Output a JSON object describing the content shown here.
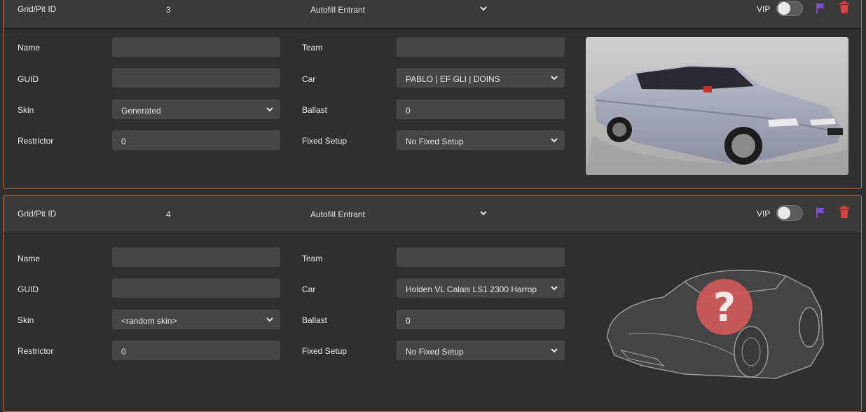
{
  "entrants": [
    {
      "header": {
        "grid_label": "Grid/Pit ID",
        "grid_value": "3",
        "autofill_label": "Autofill Entrant",
        "vip_label": "VIP"
      },
      "fields": {
        "name_label": "Name",
        "name_value": "",
        "guid_label": "GUID",
        "guid_value": "",
        "skin_label": "Skin",
        "skin_value": "Generated",
        "restrictor_label": "Restrictor",
        "restrictor_value": "0",
        "team_label": "Team",
        "team_value": "",
        "car_label": "Car",
        "car_value": "PABLO | EF GLI | DOINS",
        "ballast_label": "Ballast",
        "ballast_value": "0",
        "setup_label": "Fixed Setup",
        "setup_value": "No Fixed Setup"
      }
    },
    {
      "header": {
        "grid_label": "Grid/Pit ID",
        "grid_value": "4",
        "autofill_label": "Autofill Entrant",
        "vip_label": "VIP"
      },
      "fields": {
        "name_label": "Name",
        "name_value": "",
        "guid_label": "GUID",
        "guid_value": "",
        "skin_label": "Skin",
        "skin_value": "<random skin>",
        "restrictor_label": "Restrictor",
        "restrictor_value": "0",
        "team_label": "Team",
        "team_value": "",
        "car_label": "Car",
        "car_value": "Holden VL Calais LS1 2300 Harrop",
        "ballast_label": "Ballast",
        "ballast_value": "0",
        "setup_label": "Fixed Setup",
        "setup_value": "No Fixed Setup"
      }
    }
  ],
  "icons": {
    "flag": "flag-icon",
    "trash": "trash-icon",
    "chevron": "chevron-down-icon",
    "unknown_car": "question-mark-icon"
  },
  "colors": {
    "accent_border": "#c8702a",
    "flag": "#7b4bd6",
    "trash": "#e0403a",
    "placeholder_badge": "#d55a5a"
  }
}
